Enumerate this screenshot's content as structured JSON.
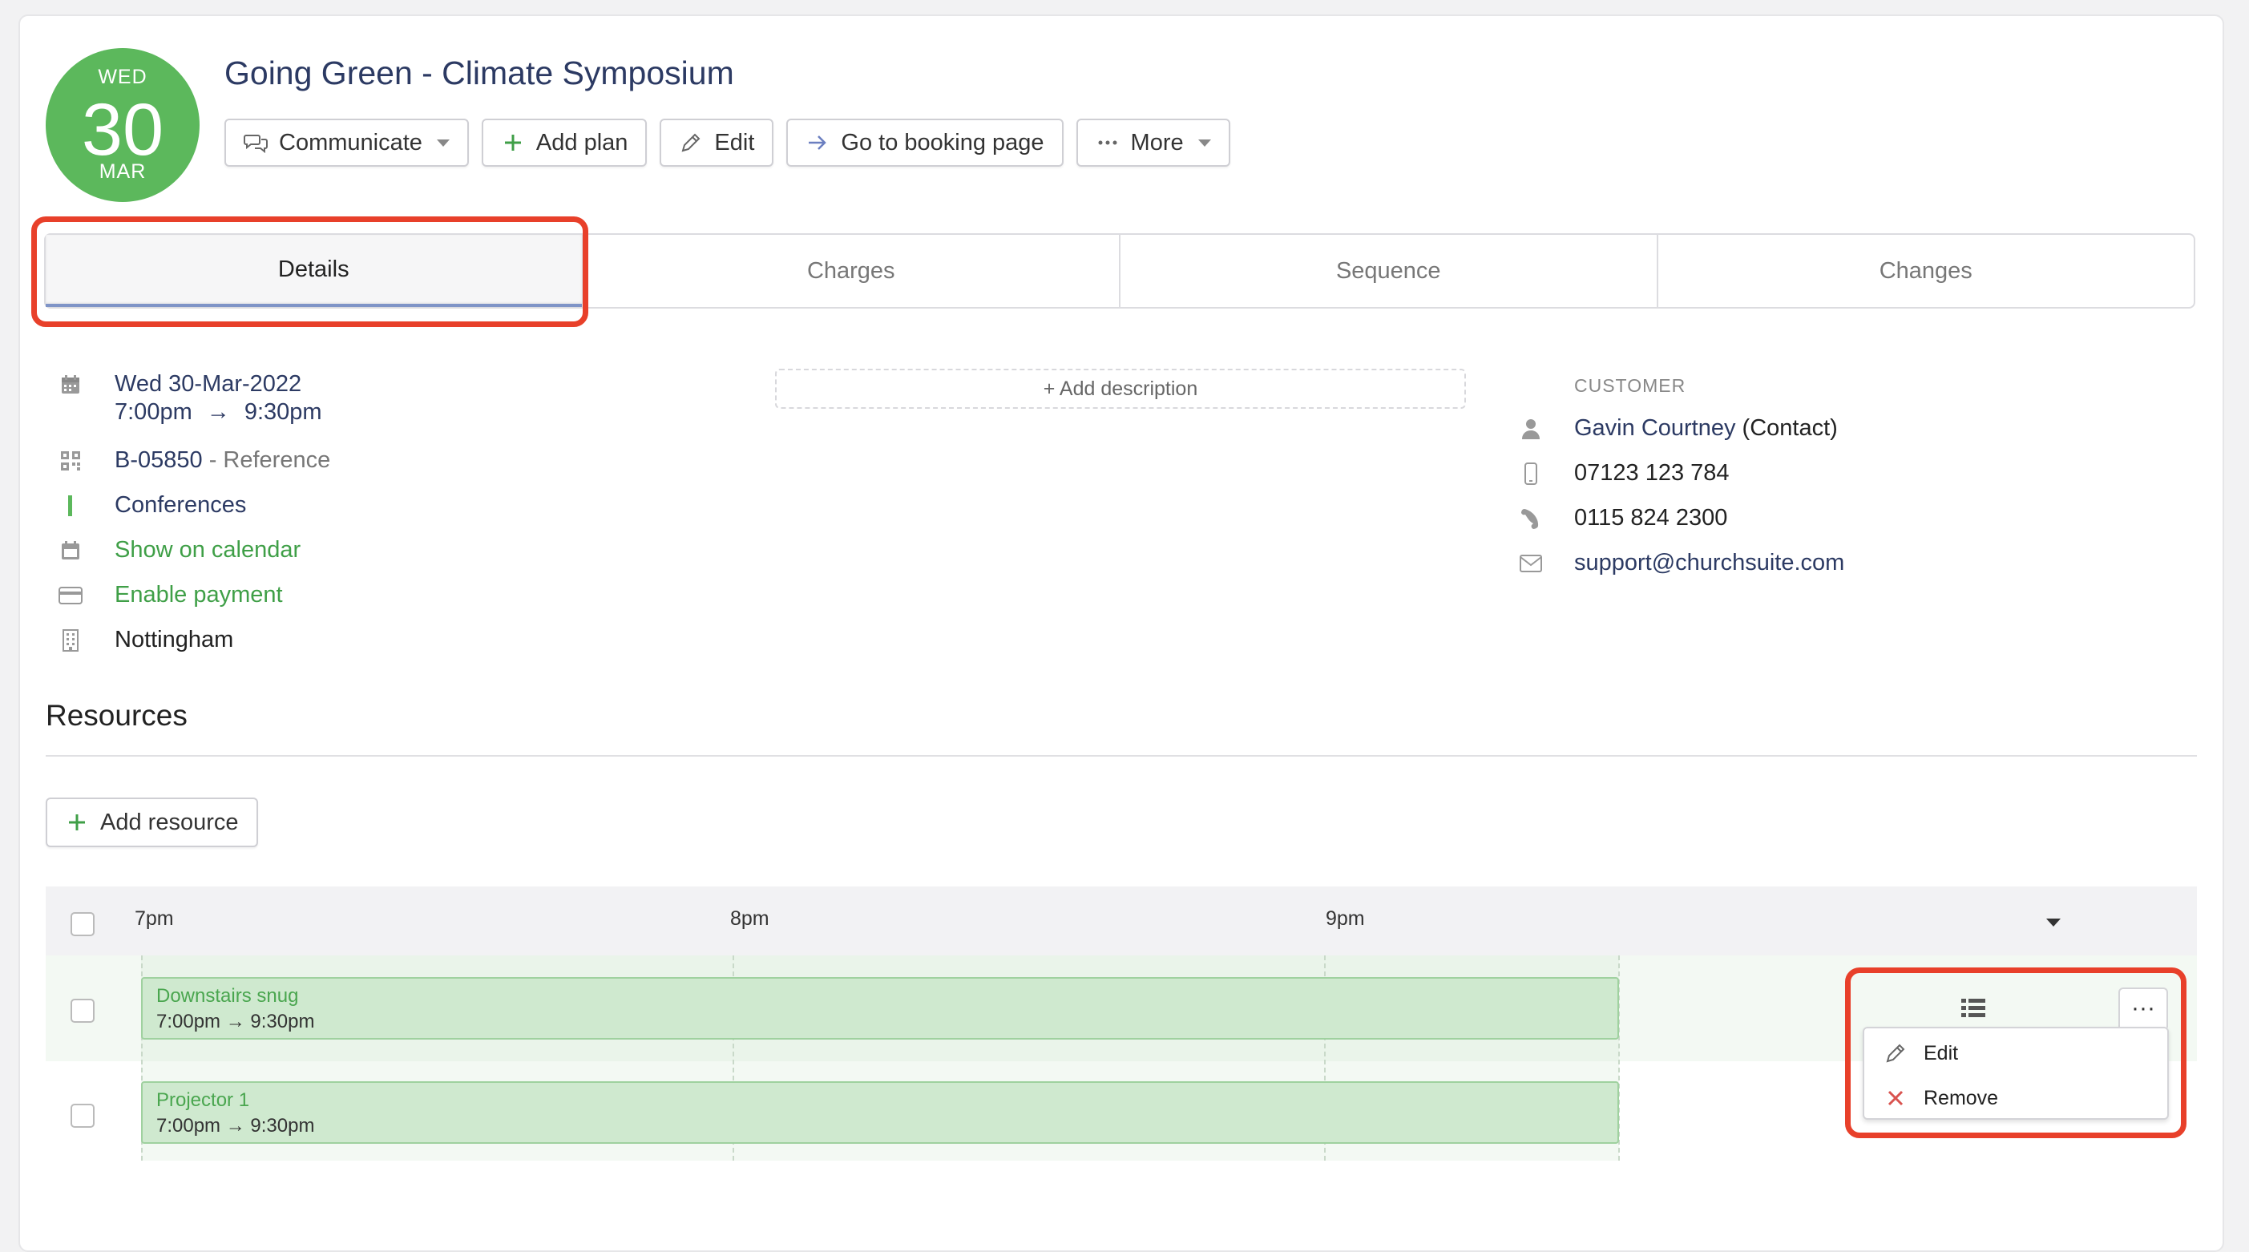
{
  "event": {
    "date_badge": {
      "dow": "WED",
      "day": "30",
      "month": "MAR",
      "color": "#5cb85c"
    },
    "title": "Going Green - Climate Symposium"
  },
  "toolbar": {
    "communicate_label": "Communicate",
    "add_plan_label": "Add plan",
    "edit_label": "Edit",
    "booking_page_label": "Go to booking page",
    "more_label": "More"
  },
  "tabs": [
    {
      "label": "Details",
      "active": true
    },
    {
      "label": "Charges",
      "active": false
    },
    {
      "label": "Sequence",
      "active": false
    },
    {
      "label": "Changes",
      "active": false
    }
  ],
  "details": {
    "date": "Wed 30-Mar-2022",
    "start_time": "7:00pm",
    "arrow": "→",
    "end_time": "9:30pm",
    "reference_code": "B-05850",
    "reference_suffix": " - Reference",
    "category": "Conferences",
    "show_on_calendar": "Show on calendar",
    "enable_payment": "Enable payment",
    "location": "Nottingham"
  },
  "description": {
    "add_label": "+ Add description"
  },
  "customer": {
    "heading": "CUSTOMER",
    "name": "Gavin Courtney",
    "role": " (Contact)",
    "mobile": "07123 123 784",
    "phone": "0115 824 2300",
    "email": "support@churchsuite.com"
  },
  "resources": {
    "title": "Resources",
    "add_label": "Add resource",
    "timeline_labels": [
      "7pm",
      "8pm",
      "9pm"
    ],
    "items": [
      {
        "name": "Downstairs snug",
        "time": "7:00pm → 9:30pm"
      },
      {
        "name": "Projector 1",
        "time": "7:00pm → 9:30pm"
      }
    ]
  },
  "row_menu": {
    "more_glyph": "···",
    "items": [
      {
        "label": "Edit",
        "icon": "pencil-icon"
      },
      {
        "label": "Remove",
        "icon": "close-icon"
      }
    ]
  },
  "colors": {
    "accent_navy": "#2c3a63",
    "success_green": "#3f9f47",
    "highlight_red": "#e8402a",
    "booking_fill": "#cfe9cf"
  }
}
